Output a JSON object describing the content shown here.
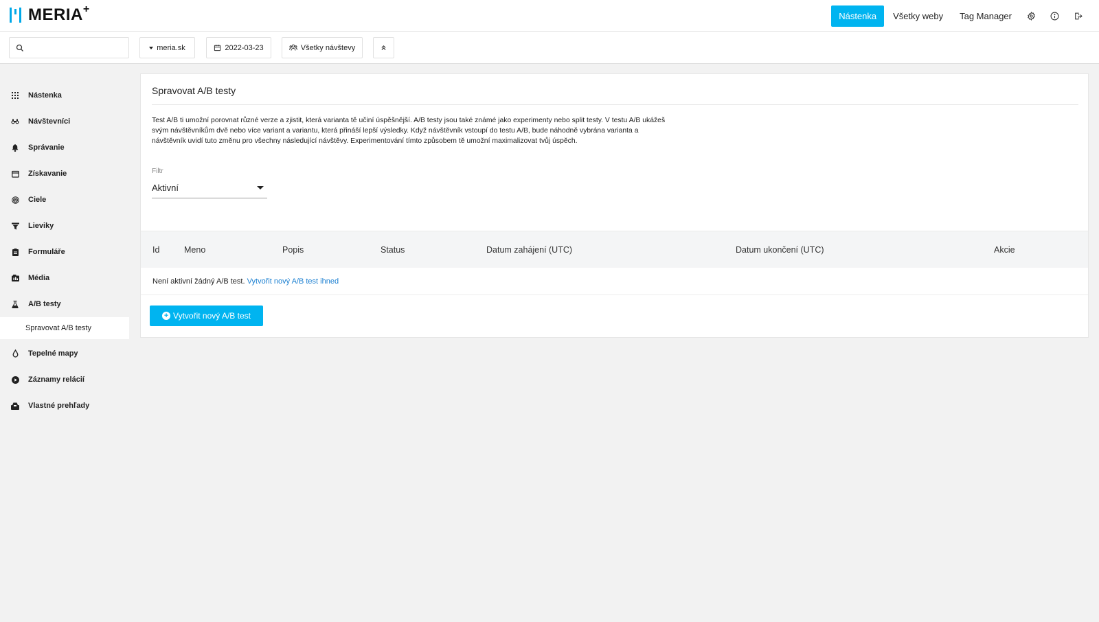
{
  "header": {
    "logo_text": "MERIA",
    "logo_plus": "+",
    "nav": [
      {
        "label": "Nástenka",
        "active": true
      },
      {
        "label": "Všetky weby",
        "active": false
      },
      {
        "label": "Tag Manager",
        "active": false
      }
    ],
    "icons": [
      "gear-icon",
      "info-icon",
      "logout-icon"
    ],
    "accent_color": "#00b4f0"
  },
  "toolbar": {
    "search_placeholder": "",
    "site_selector": "meria.sk",
    "date": "2022-03-23",
    "segment": "Všetky návštevy"
  },
  "sidebar": {
    "items": [
      {
        "label": "Nástenka",
        "icon": "grid-icon"
      },
      {
        "label": "Návštevníci",
        "icon": "binoculars-icon"
      },
      {
        "label": "Správanie",
        "icon": "bell-icon"
      },
      {
        "label": "Získavanie",
        "icon": "calendar-icon"
      },
      {
        "label": "Ciele",
        "icon": "target-icon"
      },
      {
        "label": "Lieviky",
        "icon": "funnel-icon"
      },
      {
        "label": "Formuláře",
        "icon": "form-icon"
      },
      {
        "label": "Média",
        "icon": "media-icon"
      },
      {
        "label": "A/B testy",
        "icon": "flask-icon"
      }
    ],
    "active_sub": "Spravovat A/B testy",
    "items_after": [
      {
        "label": "Tepelné mapy",
        "icon": "drop-icon"
      },
      {
        "label": "Záznamy relácií",
        "icon": "play-icon"
      },
      {
        "label": "Vlastné prehľady",
        "icon": "inbox-icon"
      }
    ]
  },
  "main": {
    "title": "Spravovat A/B testy",
    "description": "Test A/B ti umožní porovnat různé verze a zjistit, která varianta tě učiní úspěšnější. A/B testy jsou také známé jako experimenty nebo split testy. V testu A/B ukážeš svým návštěvníkům dvě nebo více variant a variantu, která přináší lepší výsledky. Když návštěvník vstoupí do testu A/B, bude náhodně vybrána varianta a návštěvník uvidí tuto změnu pro všechny následující návštěvy. Experimentování tímto způsobem tě umožní maximalizovat tvůj úspěch.",
    "filter": {
      "label": "Filtr",
      "value": "Aktivní"
    },
    "table": {
      "columns": [
        "Id",
        "Meno",
        "Popis",
        "Status",
        "Datum zahájení (UTC)",
        "Datum ukončení (UTC)",
        "Akcie"
      ],
      "empty_text": "Není aktivní žádný A/B test.",
      "empty_link": "Vytvořit nový A/B test ihned"
    },
    "create_button": "Vytvořit nový A/B test"
  }
}
